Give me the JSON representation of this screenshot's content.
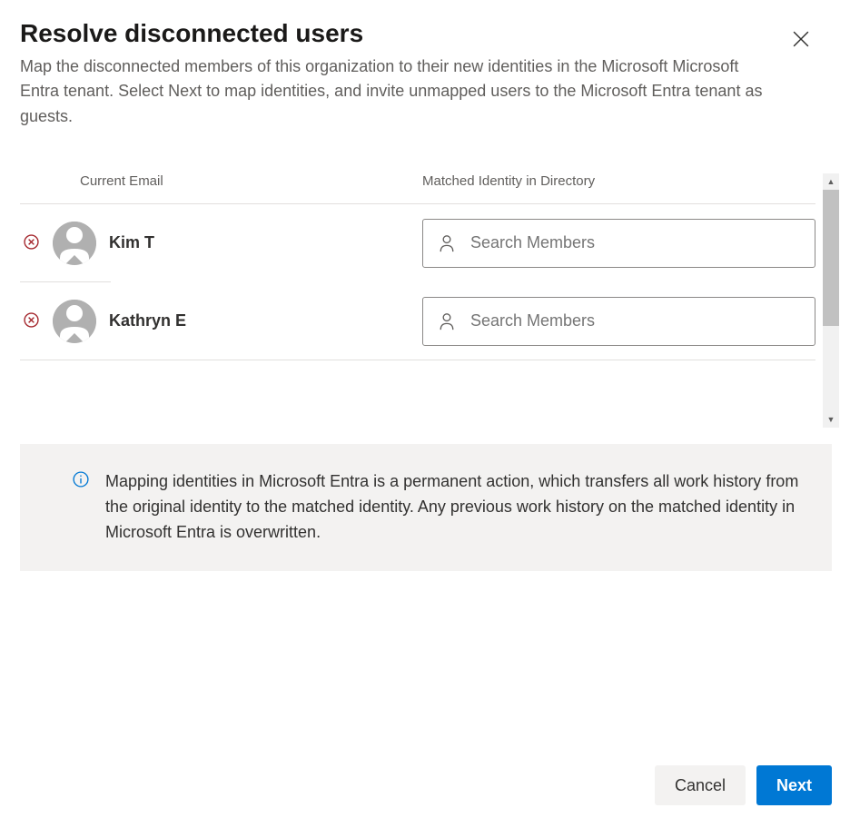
{
  "header": {
    "title": "Resolve disconnected users",
    "description": "Map the disconnected members of this organization to their new identities in the Microsoft Microsoft Entra tenant. Select Next to map identities, and invite unmapped users to the Microsoft Entra tenant as guests."
  },
  "columns": {
    "email": "Current Email",
    "matched": "Matched Identity in Directory"
  },
  "search_placeholder": "Search Members",
  "users": [
    {
      "name": "Kim T"
    },
    {
      "name": "Kathryn E"
    }
  ],
  "info": {
    "text": "Mapping identities in Microsoft Entra is a permanent action, which transfers all work history from the original identity to the matched identity. Any previous work history on the matched identity in Microsoft Entra is overwritten."
  },
  "footer": {
    "cancel": "Cancel",
    "next": "Next"
  }
}
